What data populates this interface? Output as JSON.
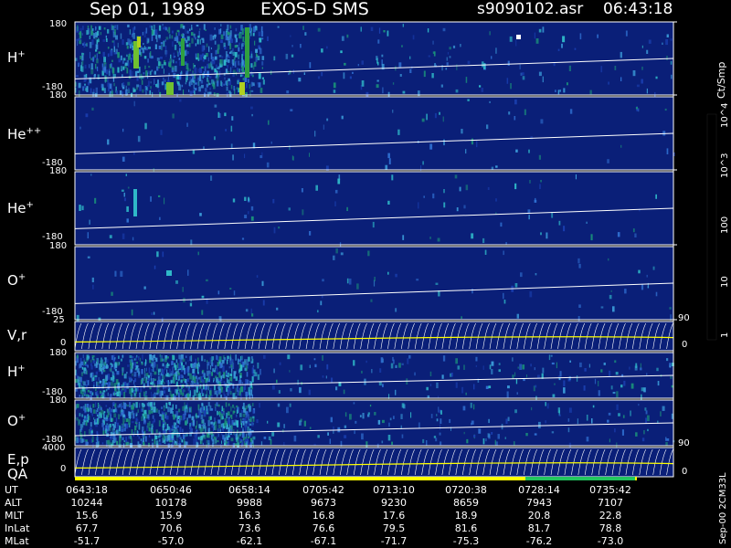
{
  "header": {
    "date": "Sep 01, 1989",
    "instrument": "EXOS-D SMS",
    "file": "s9090102.asr",
    "time": "06:43:18"
  },
  "colors": {
    "background_panel": "#0a1f78",
    "frame": "#ffffff",
    "trace": "#ffffff",
    "accent_yellow": "#ffff00",
    "accent_green": "#22c55e"
  },
  "colorbar": {
    "unit": "Ct/Smp",
    "labels": [
      "1",
      "10",
      "100",
      "10^3",
      "10^4"
    ],
    "colors": [
      "#0a1f78",
      "#1a3fb0",
      "#2f6fd0",
      "#2fb8c8",
      "#1a8f7a",
      "#30a040",
      "#70c030",
      "#b0d020",
      "#ffff00",
      "#c8b040",
      "#9a7830",
      "#b03020",
      "#ff0000",
      "#8a1010",
      "#ffffff"
    ]
  },
  "chart_data": [
    {
      "type": "heatmap",
      "title": "",
      "label_base": "H",
      "label_sup": "+",
      "ylim": [
        -180,
        180
      ],
      "ytick_top": "180",
      "ytick_bottom": "-180"
    },
    {
      "type": "heatmap",
      "title": "",
      "label_base": "He",
      "label_sup": "++",
      "ylim": [
        -180,
        180
      ],
      "ytick_top": "180",
      "ytick_bottom": "-180"
    },
    {
      "type": "heatmap",
      "title": "",
      "label_base": "He",
      "label_sup": "+",
      "ylim": [
        -180,
        180
      ],
      "ytick_top": "180",
      "ytick_bottom": "-180"
    },
    {
      "type": "heatmap",
      "title": "",
      "label_base": "O",
      "label_sup": "+",
      "ylim": [
        -180,
        180
      ],
      "ytick_top": "180",
      "ytick_bottom": "-180"
    },
    {
      "type": "line",
      "title": "",
      "label_base": "V,r",
      "label_sup": "",
      "ylim": [
        0,
        25
      ],
      "ytick_top": "25",
      "ytick_bottom": "0",
      "right_ticks": [
        "90",
        "0"
      ]
    },
    {
      "type": "heatmap",
      "title": "",
      "label_base": "H",
      "label_sup": "+",
      "ylim": [
        -180,
        180
      ],
      "ytick_top": "180",
      "ytick_bottom": "-180"
    },
    {
      "type": "heatmap",
      "title": "",
      "label_base": "O",
      "label_sup": "+",
      "ylim": [
        -180,
        180
      ],
      "ytick_top": "180",
      "ytick_bottom": "-180"
    },
    {
      "type": "line",
      "title": "",
      "label_base": "E,p",
      "label_sup": "",
      "ylim": [
        0,
        4000
      ],
      "ytick_top": "4000",
      "ytick_bottom": "0",
      "right_ticks": [
        "90",
        "0"
      ]
    }
  ],
  "qa": {
    "label": "QA"
  },
  "footer": {
    "rows": [
      {
        "label": "UT",
        "values": [
          "0643:18",
          "0650:46",
          "0658:14",
          "0705:42",
          "0713:10",
          "0720:38",
          "0728:14",
          "0735:42"
        ]
      },
      {
        "label": "ALT",
        "values": [
          "10244",
          "10178",
          "9988",
          "9673",
          "9230",
          "8659",
          "7943",
          "7107"
        ]
      },
      {
        "label": "MLT",
        "values": [
          "15.6",
          "15.9",
          "16.3",
          "16.8",
          "17.6",
          "18.9",
          "20.8",
          "22.8"
        ]
      },
      {
        "label": "InLat",
        "values": [
          "67.7",
          "70.6",
          "73.6",
          "76.6",
          "79.5",
          "81.6",
          "81.7",
          "78.8"
        ]
      },
      {
        "label": "MLat",
        "values": [
          "-51.7",
          "-57.0",
          "-62.1",
          "-67.1",
          "-71.7",
          "-75.3",
          "-76.2",
          "-73.0"
        ]
      }
    ],
    "stamp": "Sep-00 2CM33L"
  }
}
